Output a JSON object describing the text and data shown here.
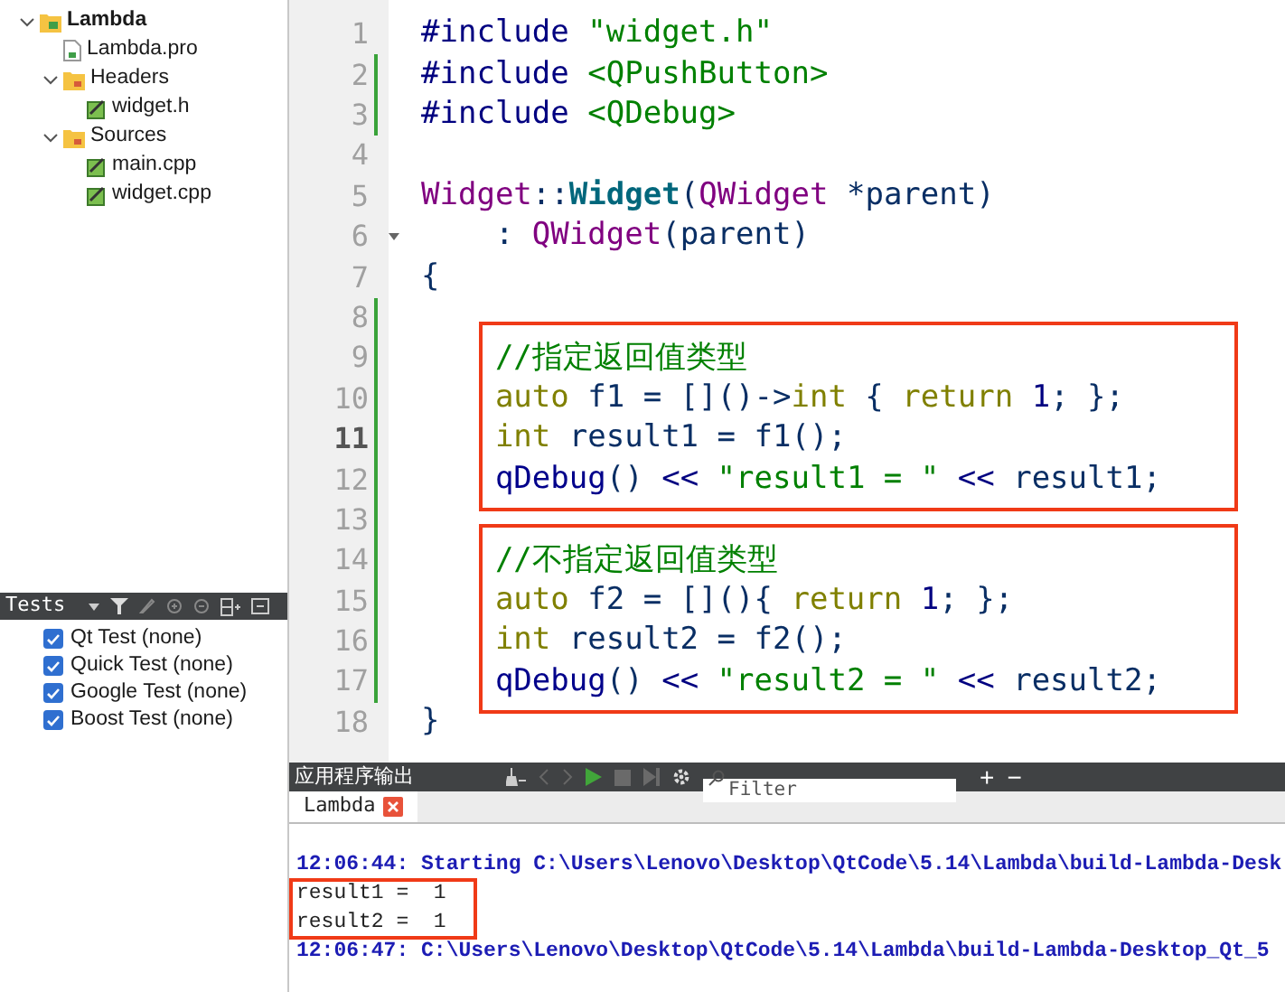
{
  "project_tree": [
    {
      "label": "Lambda",
      "kind": "project",
      "expanded": true,
      "children": [
        {
          "label": "Lambda.pro",
          "kind": "pro-file"
        },
        {
          "label": "Headers",
          "kind": "folder",
          "expanded": true,
          "children": [
            {
              "label": "widget.h",
              "kind": "source"
            }
          ]
        },
        {
          "label": "Sources",
          "kind": "folder",
          "expanded": true,
          "children": [
            {
              "label": "main.cpp",
              "kind": "source"
            },
            {
              "label": "widget.cpp",
              "kind": "source"
            }
          ]
        }
      ]
    }
  ],
  "tests_panel": {
    "title": "Tests",
    "items": [
      {
        "label": "Qt Test (none)",
        "checked": true
      },
      {
        "label": "Quick Test (none)",
        "checked": true
      },
      {
        "label": "Google Test (none)",
        "checked": true
      },
      {
        "label": "Boost Test (none)",
        "checked": true
      }
    ]
  },
  "editor": {
    "groups": [
      {
        "boxed": false,
        "lines": [
          {
            "number": "1",
            "changed": false,
            "current": false,
            "foldable": false,
            "tokens": [
              {
                "kind": "pp",
                "text": "#include"
              },
              {
                "kind": "str",
                "text": " \"widget.h\""
              }
            ]
          },
          {
            "number": "2",
            "changed": true,
            "current": false,
            "foldable": false,
            "tokens": [
              {
                "kind": "pp",
                "text": "#include"
              },
              {
                "kind": "str",
                "text": " <QPushButton>"
              }
            ]
          },
          {
            "number": "3",
            "changed": true,
            "current": false,
            "foldable": false,
            "tokens": [
              {
                "kind": "pp",
                "text": "#include"
              },
              {
                "kind": "str",
                "text": " <QDebug>"
              }
            ]
          },
          {
            "number": "4",
            "changed": false,
            "current": false,
            "foldable": false
          },
          {
            "number": "5",
            "changed": false,
            "current": false,
            "foldable": false,
            "tokens": [
              {
                "kind": "type",
                "text": "Widget"
              },
              {
                "kind": "plain",
                "text": "::"
              },
              {
                "kind": "decl",
                "text": "Widget"
              },
              {
                "kind": "plain",
                "text": "("
              },
              {
                "kind": "type",
                "text": "QWidget"
              },
              {
                "kind": "plain",
                "text": " *parent)"
              }
            ]
          },
          {
            "number": "6",
            "changed": false,
            "current": false,
            "foldable": true,
            "tokens": [
              {
                "kind": "plain",
                "text": "    :"
              },
              {
                "kind": "type",
                "text": " QWidget"
              },
              {
                "kind": "plain",
                "text": "(parent)"
              }
            ]
          },
          {
            "number": "7",
            "changed": false,
            "current": false,
            "foldable": false,
            "tokens": [
              {
                "kind": "plain",
                "text": "{"
              }
            ]
          },
          {
            "number": "8",
            "changed": true,
            "current": false,
            "foldable": false
          }
        ]
      },
      {
        "boxed": true,
        "lines": [
          {
            "number": "9",
            "changed": true,
            "current": false,
            "foldable": false,
            "tokens": [
              {
                "kind": "comment",
                "text": "    //指定返回值类型"
              }
            ]
          },
          {
            "number": "10",
            "changed": true,
            "current": false,
            "foldable": false,
            "tokens": [
              {
                "kind": "kw",
                "text": "    auto"
              },
              {
                "kind": "plain",
                "text": " f1 = []()->"
              },
              {
                "kind": "kw",
                "text": "int"
              },
              {
                "kind": "plain",
                "text": " { "
              },
              {
                "kind": "kw",
                "text": "return"
              },
              {
                "kind": "num",
                "text": " 1"
              },
              {
                "kind": "plain",
                "text": "; };"
              }
            ]
          },
          {
            "number": "11",
            "changed": true,
            "current": true,
            "foldable": false,
            "tokens": [
              {
                "kind": "kw",
                "text": "    int"
              },
              {
                "kind": "plain",
                "text": " result1 = f1();"
              }
            ]
          },
          {
            "number": "12",
            "changed": true,
            "current": false,
            "foldable": false,
            "tokens": [
              {
                "kind": "call",
                "text": "    qDebug"
              },
              {
                "kind": "plain",
                "text": "() "
              },
              {
                "kind": "op",
                "text": "<<"
              },
              {
                "kind": "str",
                "text": " \"result1 = \" "
              },
              {
                "kind": "op",
                "text": "<<"
              },
              {
                "kind": "plain",
                "text": " result1;"
              }
            ]
          }
        ]
      },
      {
        "boxed": false,
        "lines": [
          {
            "number": "13",
            "changed": true,
            "current": false,
            "foldable": false
          }
        ]
      },
      {
        "boxed": true,
        "lines": [
          {
            "number": "14",
            "changed": true,
            "current": false,
            "foldable": false,
            "tokens": [
              {
                "kind": "comment",
                "text": "    //不指定返回值类型"
              }
            ]
          },
          {
            "number": "15",
            "changed": true,
            "current": false,
            "foldable": false,
            "tokens": [
              {
                "kind": "kw",
                "text": "    auto"
              },
              {
                "kind": "plain",
                "text": " f2 = [](){ "
              },
              {
                "kind": "kw",
                "text": "return"
              },
              {
                "kind": "num",
                "text": " 1"
              },
              {
                "kind": "plain",
                "text": "; };"
              }
            ]
          },
          {
            "number": "16",
            "changed": true,
            "current": false,
            "foldable": false,
            "tokens": [
              {
                "kind": "kw",
                "text": "    int"
              },
              {
                "kind": "plain",
                "text": " result2 = f2();"
              }
            ]
          },
          {
            "number": "17",
            "changed": true,
            "current": false,
            "foldable": false,
            "tokens": [
              {
                "kind": "call",
                "text": "    qDebug"
              },
              {
                "kind": "plain",
                "text": "() "
              },
              {
                "kind": "op",
                "text": "<<"
              },
              {
                "kind": "str",
                "text": " \"result2 = \" "
              },
              {
                "kind": "op",
                "text": "<<"
              },
              {
                "kind": "plain",
                "text": " result2;"
              }
            ]
          }
        ]
      },
      {
        "boxed": false,
        "lines": [
          {
            "number": "18",
            "changed": false,
            "current": false,
            "foldable": false,
            "tokens": [
              {
                "kind": "plain",
                "text": "}"
              }
            ]
          }
        ]
      }
    ]
  },
  "output_pane": {
    "title": "应用程序输出",
    "filter": {
      "placeholder": "Filter"
    },
    "add_button": "+",
    "remove_button": "−",
    "tabs": [
      {
        "label": "Lambda",
        "selected": true
      }
    ],
    "groups": [
      {
        "boxed": false,
        "lines": [
          {
            "kind": "info",
            "text": "12:06:44: Starting C:\\Users\\Lenovo\\Desktop\\QtCode\\5.14\\Lambda\\build-Lambda-Desk"
          }
        ]
      },
      {
        "boxed": true,
        "lines": [
          {
            "kind": "plain",
            "text": "result1 =  1"
          },
          {
            "kind": "plain",
            "text": "result2 =  1"
          }
        ]
      },
      {
        "boxed": false,
        "lines": [
          {
            "kind": "info",
            "text": "12:06:47: C:\\Users\\Lenovo\\Desktop\\QtCode\\5.14\\Lambda\\build-Lambda-Desktop_Qt_5"
          }
        ]
      }
    ]
  }
}
